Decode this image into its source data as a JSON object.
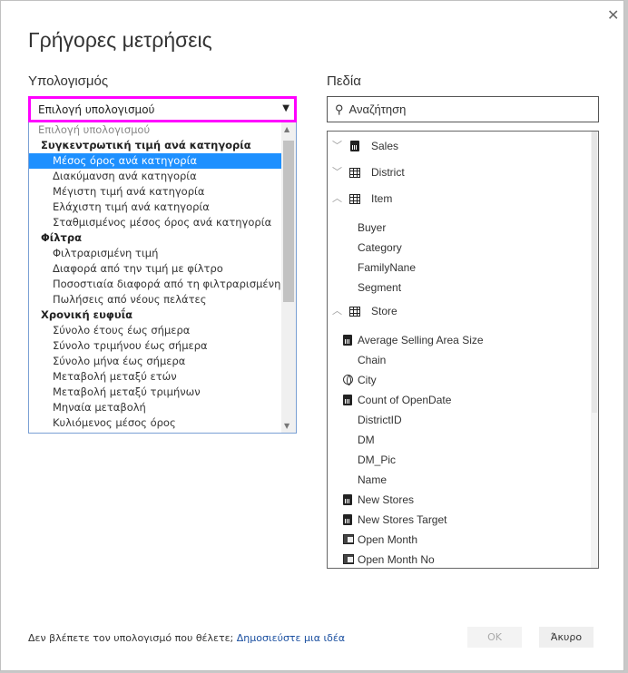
{
  "dialog": {
    "title": "Γρήγορες μετρήσεις",
    "close_icon": "close-icon"
  },
  "calc": {
    "label": "Υπολογισμός",
    "selected": "Επιλογή υπολογισμού",
    "options": [
      {
        "t": "ph",
        "label": "Επιλογή υπολογισμού"
      },
      {
        "t": "grp",
        "label": "Συγκεντρωτική τιμή ανά κατηγορία"
      },
      {
        "t": "it",
        "label": "Μέσος όρος ανά κατηγορία",
        "highlighted": true
      },
      {
        "t": "it",
        "label": "Διακύμανση ανά κατηγορία"
      },
      {
        "t": "it",
        "label": "Μέγιστη τιμή ανά κατηγορία"
      },
      {
        "t": "it",
        "label": "Ελάχιστη τιμή ανά κατηγορία"
      },
      {
        "t": "it",
        "label": "Σταθμισμένος μέσος όρος ανά κατηγορία"
      },
      {
        "t": "grp",
        "label": "Φίλτρα"
      },
      {
        "t": "it",
        "label": "Φιλτραρισμένη τιμή"
      },
      {
        "t": "it",
        "label": "Διαφορά από την τιμή με φίλτρο"
      },
      {
        "t": "it",
        "label": "Ποσοστιαία διαφορά από τη φιλτραρισμένη τιμή"
      },
      {
        "t": "it",
        "label": "Πωλήσεις από νέους πελάτες"
      },
      {
        "t": "grp",
        "label": "Χρονική ευφυΐα"
      },
      {
        "t": "it",
        "label": "Σύνολο έτους έως σήμερα"
      },
      {
        "t": "it",
        "label": "Σύνολο τριμήνου έως σήμερα"
      },
      {
        "t": "it",
        "label": "Σύνολο μήνα έως σήμερα"
      },
      {
        "t": "it",
        "label": "Μεταβολή μεταξύ ετών"
      },
      {
        "t": "it",
        "label": "Μεταβολή μεταξύ τριμήνων"
      },
      {
        "t": "it",
        "label": "Μηναία μεταβολή"
      },
      {
        "t": "it",
        "label": "Κυλιόμενος μέσος όρος"
      }
    ]
  },
  "fields": {
    "label": "Πεδία",
    "search_placeholder": "Αναζήτηση",
    "items": [
      {
        "kind": "table",
        "label": "Sales",
        "icon": "calculator-icon",
        "expanded": false
      },
      {
        "kind": "table",
        "label": "District",
        "icon": "table-icon",
        "expanded": false
      },
      {
        "kind": "table",
        "label": "Item",
        "icon": "table-icon",
        "expanded": true
      },
      {
        "kind": "field",
        "label": "Buyer"
      },
      {
        "kind": "field",
        "label": "Category"
      },
      {
        "kind": "field",
        "label": "FamilyNane"
      },
      {
        "kind": "field",
        "label": "Segment"
      },
      {
        "kind": "table",
        "label": "Store",
        "icon": "table-icon",
        "expanded": true
      },
      {
        "kind": "field",
        "label": "Average Selling Area Size",
        "icon": "calculator-icon"
      },
      {
        "kind": "field",
        "label": "Chain"
      },
      {
        "kind": "field",
        "label": "City",
        "icon": "globe-icon"
      },
      {
        "kind": "field",
        "label": "Count of OpenDate",
        "icon": "calculator-icon"
      },
      {
        "kind": "field",
        "label": "DistrictID"
      },
      {
        "kind": "field",
        "label": "DM"
      },
      {
        "kind": "field",
        "label": "DM_Pic"
      },
      {
        "kind": "field",
        "label": "Name"
      },
      {
        "kind": "field",
        "label": "New Stores",
        "icon": "calculator-icon"
      },
      {
        "kind": "field",
        "label": "New Stores Target",
        "icon": "calculator-icon"
      },
      {
        "kind": "field",
        "label": "Open Month",
        "icon": "calendar-hierarchy-icon"
      },
      {
        "kind": "field",
        "label": "Open Month No",
        "icon": "calendar-hierarchy-icon"
      }
    ]
  },
  "footer": {
    "text": "Δεν βλέπετε τον υπολογισμό που θέλετε; ",
    "link": "Δημοσιεύστε μια ιδέα",
    "ok": "OK",
    "cancel": "Άκυρο"
  },
  "colors": {
    "highlight": "#1e90ff",
    "focus_border": "#ff00ff",
    "link": "#1a4fa0"
  }
}
